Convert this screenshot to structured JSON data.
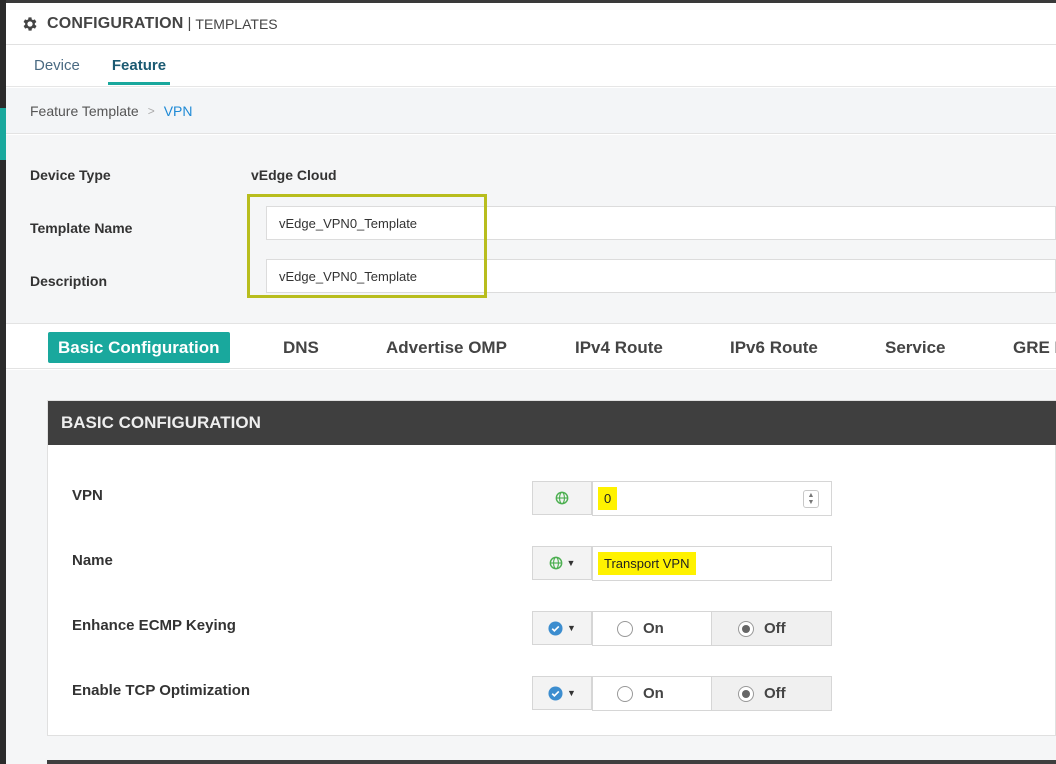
{
  "header": {
    "title": "CONFIGURATION",
    "separator": "|",
    "subtitle": "TEMPLATES",
    "icon": "gear-icon"
  },
  "tabs": [
    {
      "label": "Device",
      "active": false
    },
    {
      "label": "Feature",
      "active": true
    }
  ],
  "breadcrumb": {
    "root": "Feature Template",
    "separator": ">",
    "current": "VPN"
  },
  "form": {
    "device_type_label": "Device Type",
    "device_type_value": "vEdge Cloud",
    "template_name_label": "Template Name",
    "template_name_value": "vEdge_VPN0_Template",
    "description_label": "Description",
    "description_value": "vEdge_VPN0_Template"
  },
  "section_tabs": [
    "Basic Configuration",
    "DNS",
    "Advertise OMP",
    "IPv4 Route",
    "IPv6 Route",
    "Service",
    "GRE R"
  ],
  "basic_config": {
    "header": "BASIC CONFIGURATION",
    "vpn": {
      "label": "VPN",
      "value": "0",
      "scope_icon": "globe-icon"
    },
    "name": {
      "label": "Name",
      "value": "Transport VPN",
      "scope_icon": "globe-icon"
    },
    "ecmp": {
      "label": "Enhance ECMP Keying",
      "on_label": "On",
      "off_label": "Off",
      "selected": "Off",
      "scope_icon": "check-circle-icon"
    },
    "tcp": {
      "label": "Enable TCP Optimization",
      "on_label": "On",
      "off_label": "Off",
      "selected": "Off",
      "scope_icon": "check-circle-icon"
    }
  },
  "colors": {
    "accent": "#19a89d",
    "link": "#1f8ad6",
    "highlight": "#fff200",
    "panel_header": "#3f3f3f",
    "outline": "#b8bd1e",
    "check_icon": "#3c8dcf",
    "globe_icon": "#4caf50"
  }
}
